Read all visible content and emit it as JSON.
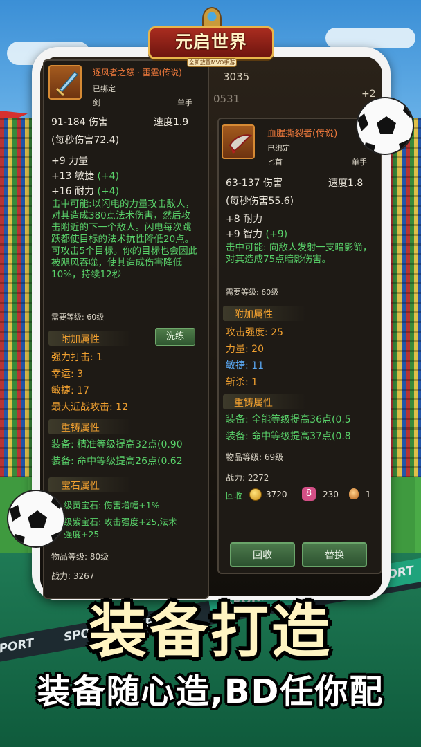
{
  "game": {
    "title": "元启世界",
    "subtitle": "全新放置MVO手游"
  },
  "top_stats": {
    "a": "3035",
    "b": "0531",
    "c": "+2"
  },
  "left_item": {
    "name": "逐风者之怒 · 雷霆(传说)",
    "bound": "已绑定",
    "type": "剑",
    "hand": "单手",
    "damage": "91-184 伤害",
    "speed": "速度1.9",
    "dps": "(每秒伤害72.4)",
    "stat_str": "+9 力量",
    "stat_agi": "+13 敏捷",
    "stat_agi_bonus": "(+4)",
    "stat_sta": "+16 耐力",
    "stat_sta_bonus": "(+4)",
    "on_hit": "击中可能:以闪电的力量攻击敌人，对其造成380点法术伤害，然后攻击附近的下一个敌人。闪电每次跳跃都使目标的法术抗性降低20点。可攻击5个目标。你的目标也会因此被飓风吞噬，使其造成伤害降低10%，持续12秒",
    "req_level": "需要等级: 60级",
    "extra_title": "附加属性",
    "wash_button": "洗练",
    "extra_1": "强力打击: 1",
    "extra_2": "幸运: 3",
    "extra_3": "敏捷: 17",
    "extra_4": "最大近战攻击: 12",
    "reforge_title": "重铸属性",
    "reforge_1": "装备: 精准等级提高32点(0.90",
    "reforge_2": "装备: 命中等级提高26点(0.62",
    "gem_title": "宝石属性",
    "gem_1": "级黄宝石: 伤害增幅+1%",
    "gem_2": "级紫宝石: 攻击强度+25,法术",
    "gem_3": "强度+25",
    "item_level": "物品等级: 80级",
    "power": "战力: 3267"
  },
  "right_item": {
    "name": "血腥撕裂者(传说)",
    "bound": "已绑定",
    "type": "匕首",
    "hand": "单手",
    "damage": "63-137 伤害",
    "speed": "速度1.8",
    "dps": "(每秒伤害55.6)",
    "stat_sta": "+8 耐力",
    "stat_int": "+9 智力",
    "stat_int_bonus": "(+9)",
    "on_hit": "击中可能: 向敌人发射一支暗影箭，对其造成75点暗影伤害。",
    "req_level": "需要等级: 60级",
    "extra_title": "附加属性",
    "extra_1": "攻击强度: 25",
    "extra_2": "力量: 20",
    "extra_3": "敏捷: 11",
    "extra_4": "斩杀: 1",
    "reforge_title": "重铸属性",
    "reforge_1": "装备: 全能等级提高36点(0.5",
    "reforge_2": "装备: 命中等级提高37点(0.8",
    "item_level": "物品等级: 69级",
    "power": "战力: 2272",
    "recycle_label": "回收",
    "recycle_gold": "3720",
    "recycle_gem": "230",
    "recycle_orb": "1",
    "gem_glyph": "8",
    "btn_recycle": "回收",
    "btn_replace": "替换"
  },
  "banner": {
    "sport": "SPORT"
  },
  "slogan": {
    "main": "装备打造",
    "sub": "装备随心造,BD任你配"
  },
  "colors": {
    "legend": "#f07a3c",
    "bonus": "#59d26a",
    "section": "#f0a030",
    "slogan": "#fff4c2"
  }
}
